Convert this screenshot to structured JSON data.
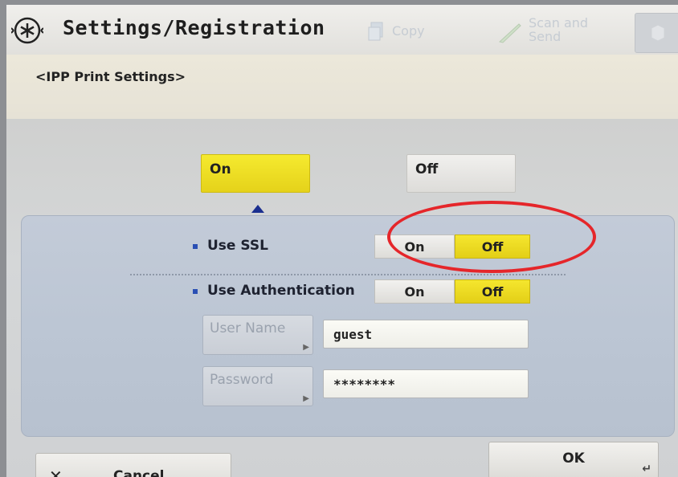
{
  "header": {
    "title": "Settings/Registration",
    "tabs": {
      "copy": "Copy",
      "scan_send": "Scan and\nSend"
    }
  },
  "breadcrumb": "<IPP Print Settings>",
  "ipp_toggle": {
    "on_label": "On",
    "off_label": "Off",
    "selected": "On"
  },
  "use_ssl": {
    "label": "Use SSL",
    "on_label": "On",
    "off_label": "Off",
    "selected": "Off"
  },
  "use_authentication": {
    "label": "Use Authentication",
    "on_label": "On",
    "off_label": "Off",
    "selected": "Off"
  },
  "user_name": {
    "button_label": "User Name",
    "value": "guest"
  },
  "password": {
    "button_label": "Password",
    "value": "********"
  },
  "footer": {
    "cancel_label": "Cancel",
    "ok_label": "OK"
  },
  "colors": {
    "selected_yellow": "#f0e024",
    "panel_blue": "#bdc6d4",
    "annotation_red": "#e5262a"
  }
}
